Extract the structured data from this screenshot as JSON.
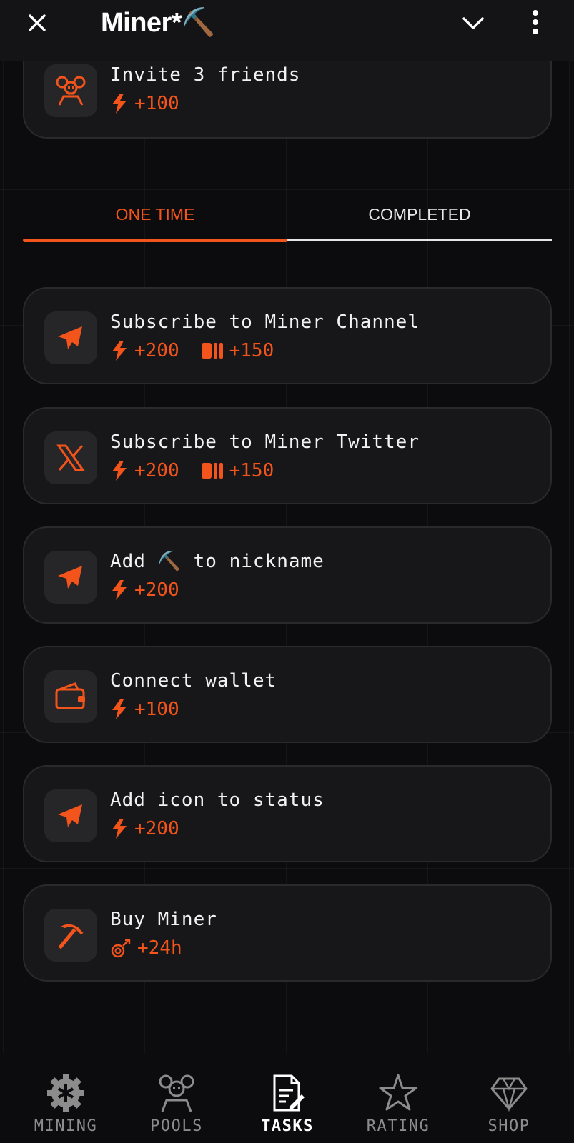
{
  "header": {
    "title": "Miner*⛏️"
  },
  "top_task": {
    "title": "Invite 3 friends",
    "rewards": [
      {
        "icon": "bolt-icon",
        "text": "+100"
      }
    ]
  },
  "tabs": [
    {
      "label": "ONE TIME",
      "active": true
    },
    {
      "label": "COMPLETED",
      "active": false
    }
  ],
  "tasks": [
    {
      "icon": "telegram-icon",
      "title": "Subscribe to Miner Channel",
      "rewards": [
        {
          "icon": "bolt-icon",
          "text": "+200"
        },
        {
          "icon": "battery-icon",
          "text": "+150"
        }
      ]
    },
    {
      "icon": "x-logo-icon",
      "title": "Subscribe to Miner Twitter",
      "rewards": [
        {
          "icon": "bolt-icon",
          "text": "+200"
        },
        {
          "icon": "battery-icon",
          "text": "+150"
        }
      ]
    },
    {
      "icon": "telegram-icon",
      "title": "Add ⛏️ to nickname",
      "rewards": [
        {
          "icon": "bolt-icon",
          "text": "+200"
        }
      ]
    },
    {
      "icon": "wallet-icon",
      "title": "Connect wallet",
      "rewards": [
        {
          "icon": "bolt-icon",
          "text": "+100"
        }
      ]
    },
    {
      "icon": "telegram-icon",
      "title": "Add icon to status",
      "rewards": [
        {
          "icon": "bolt-icon",
          "text": "+200"
        }
      ]
    },
    {
      "icon": "pickaxe-icon",
      "title": "Buy Miner",
      "rewards": [
        {
          "icon": "miner-boost-icon",
          "text": "+24h"
        }
      ]
    }
  ],
  "bottom_nav": [
    {
      "label": "MINING",
      "icon": "gear-icon",
      "active": false
    },
    {
      "label": "POOLS",
      "icon": "pools-icon",
      "active": false
    },
    {
      "label": "TASKS",
      "icon": "tasks-icon",
      "active": true
    },
    {
      "label": "RATING",
      "icon": "star-icon",
      "active": false
    },
    {
      "label": "SHOP",
      "icon": "diamond-icon",
      "active": false
    }
  ],
  "colors": {
    "accent": "#f2541b",
    "background": "#0c0c0e",
    "card": "#171719",
    "card_border": "#2a2a2c",
    "icon_tile": "#262628"
  }
}
